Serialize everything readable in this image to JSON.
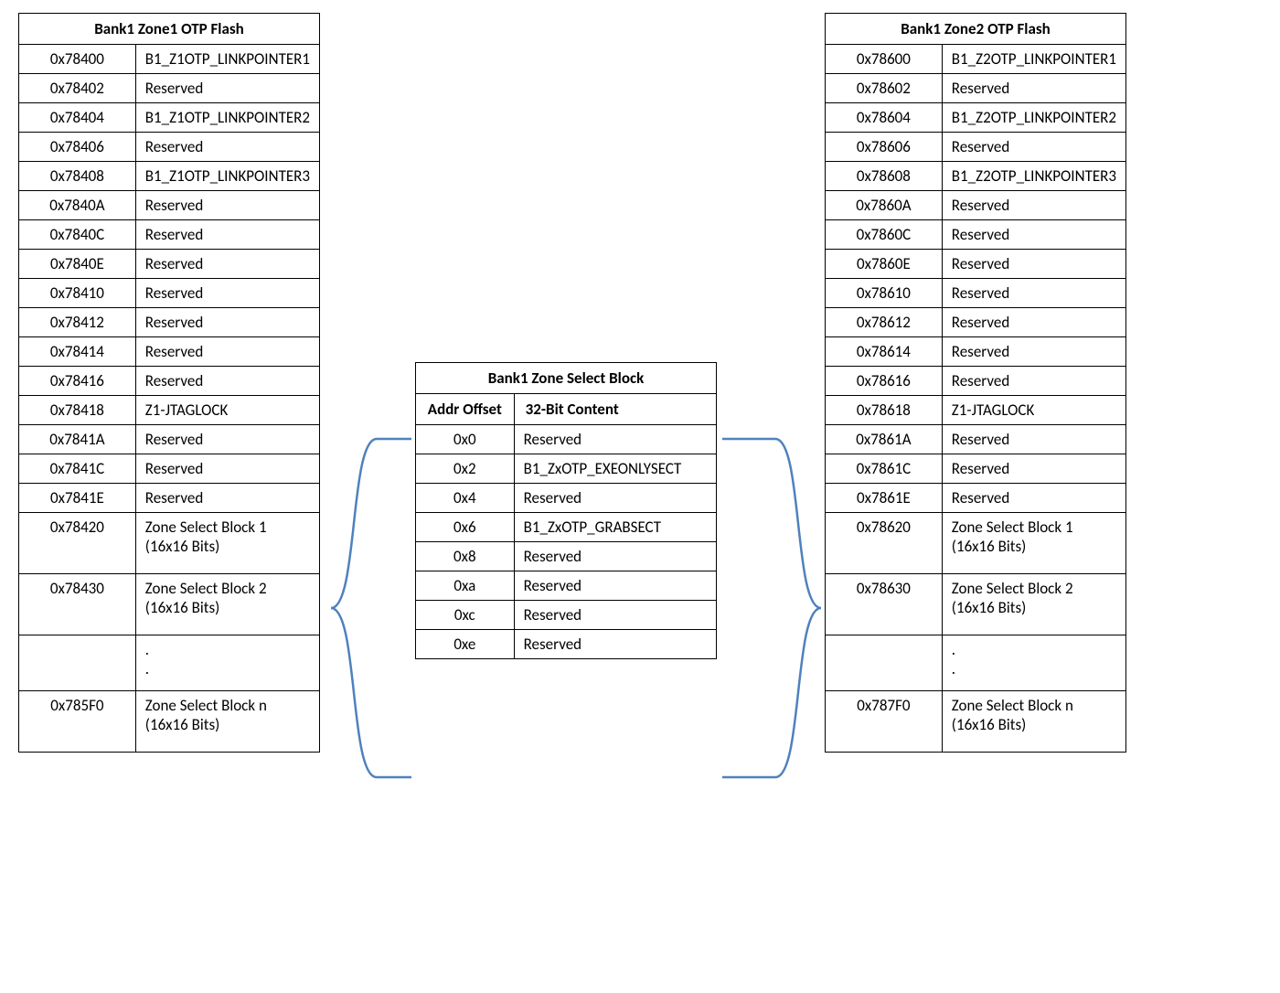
{
  "left": {
    "title": "Bank1 Zone1 OTP Flash",
    "rows": [
      {
        "addr": "0x78400",
        "desc": "B1_Z1OTP_LINKPOINTER1"
      },
      {
        "addr": "0x78402",
        "desc": "Reserved"
      },
      {
        "addr": "0x78404",
        "desc": "B1_Z1OTP_LINKPOINTER2"
      },
      {
        "addr": "0x78406",
        "desc": "Reserved"
      },
      {
        "addr": "0x78408",
        "desc": "B1_Z1OTP_LINKPOINTER3"
      },
      {
        "addr": "0x7840A",
        "desc": "Reserved"
      },
      {
        "addr": "0x7840C",
        "desc": "Reserved"
      },
      {
        "addr": "0x7840E",
        "desc": "Reserved"
      },
      {
        "addr": "0x78410",
        "desc": "Reserved"
      },
      {
        "addr": "0x78412",
        "desc": "Reserved"
      },
      {
        "addr": "0x78414",
        "desc": "Reserved"
      },
      {
        "addr": "0x78416",
        "desc": "Reserved"
      },
      {
        "addr": "0x78418",
        "desc": "Z1-JTAGLOCK"
      },
      {
        "addr": "0x7841A",
        "desc": "Reserved"
      },
      {
        "addr": "0x7841C",
        "desc": "Reserved"
      },
      {
        "addr": "0x7841E",
        "desc": "Reserved"
      },
      {
        "addr": "0x78420",
        "desc": "Zone Select Block 1 (16x16 Bits)",
        "tall": true
      },
      {
        "addr": "0x78430",
        "desc": "Zone Select Block 2 (16x16 Bits)",
        "tall": true
      },
      {
        "addr": "",
        "desc": ".\n.",
        "dots": true
      },
      {
        "addr": "0x785F0",
        "desc": "Zone Select Block n (16x16 Bits)",
        "tall": true
      }
    ]
  },
  "right": {
    "title": "Bank1 Zone2 OTP Flash",
    "rows": [
      {
        "addr": "0x78600",
        "desc": "B1_Z2OTP_LINKPOINTER1"
      },
      {
        "addr": "0x78602",
        "desc": "Reserved"
      },
      {
        "addr": "0x78604",
        "desc": "B1_Z2OTP_LINKPOINTER2"
      },
      {
        "addr": "0x78606",
        "desc": "Reserved"
      },
      {
        "addr": "0x78608",
        "desc": "B1_Z2OTP_LINKPOINTER3"
      },
      {
        "addr": "0x7860A",
        "desc": "Reserved"
      },
      {
        "addr": "0x7860C",
        "desc": "Reserved"
      },
      {
        "addr": "0x7860E",
        "desc": "Reserved"
      },
      {
        "addr": "0x78610",
        "desc": "Reserved"
      },
      {
        "addr": "0x78612",
        "desc": "Reserved"
      },
      {
        "addr": "0x78614",
        "desc": "Reserved"
      },
      {
        "addr": "0x78616",
        "desc": "Reserved"
      },
      {
        "addr": "0x78618",
        "desc": "Z1-JTAGLOCK"
      },
      {
        "addr": "0x7861A",
        "desc": "Reserved"
      },
      {
        "addr": "0x7861C",
        "desc": "Reserved"
      },
      {
        "addr": "0x7861E",
        "desc": "Reserved"
      },
      {
        "addr": "0x78620",
        "desc": "Zone Select Block 1 (16x16 Bits)",
        "tall": true
      },
      {
        "addr": "0x78630",
        "desc": "Zone Select Block 2 (16x16 Bits)",
        "tall": true
      },
      {
        "addr": "",
        "desc": ".\n.",
        "dots": true
      },
      {
        "addr": "0x787F0",
        "desc": "Zone Select Block n (16x16 Bits)",
        "tall": true
      }
    ]
  },
  "center": {
    "title": "Bank1 Zone Select Block",
    "headers": {
      "h1": "Addr Offset",
      "h2": "32-Bit Content"
    },
    "rows": [
      {
        "addr": "0x0",
        "desc": "Reserved"
      },
      {
        "addr": "0x2",
        "desc": "B1_ZxOTP_EXEONLYSECT"
      },
      {
        "addr": "0x4",
        "desc": "Reserved"
      },
      {
        "addr": "0x6",
        "desc": "B1_ZxOTP_GRABSECT"
      },
      {
        "addr": "0x8",
        "desc": "Reserved"
      },
      {
        "addr": "0xa",
        "desc": "Reserved"
      },
      {
        "addr": "0xc",
        "desc": "Reserved"
      },
      {
        "addr": "0xe",
        "desc": "Reserved"
      }
    ]
  }
}
